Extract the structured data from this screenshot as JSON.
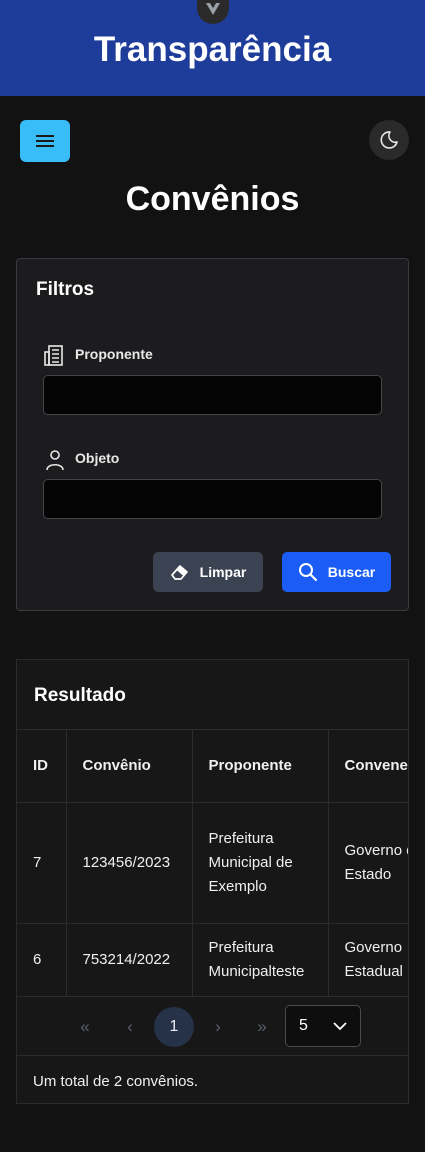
{
  "header": {
    "title": "Transparência"
  },
  "page": {
    "title": "Convênios"
  },
  "filters": {
    "title": "Filtros",
    "proponente_label": "Proponente",
    "proponente_value": "",
    "objeto_label": "Objeto",
    "objeto_value": "",
    "clear_label": "Limpar",
    "search_label": "Buscar"
  },
  "result": {
    "title": "Resultado",
    "columns": [
      "ID",
      "Convênio",
      "Proponente",
      "Convenente"
    ],
    "rows": [
      {
        "id": "7",
        "convenio": "123456/2023",
        "proponente": "Prefeitura Municipal de Exemplo",
        "convenente": "Governo do Estado"
      },
      {
        "id": "6",
        "convenio": "753214/2022",
        "proponente": "Prefeitura Municipalteste",
        "convenente": "Governo Estadual"
      }
    ],
    "pagination": {
      "first": "«",
      "prev": "‹",
      "current_page": "1",
      "next": "›",
      "last": "»",
      "page_size": "5"
    },
    "total_text": "Um total de 2 convênios."
  },
  "colors": {
    "header": "#1e3c99",
    "accent_button": "#1b5cf5",
    "menu_button": "#38bdf8",
    "background": "#121212"
  }
}
